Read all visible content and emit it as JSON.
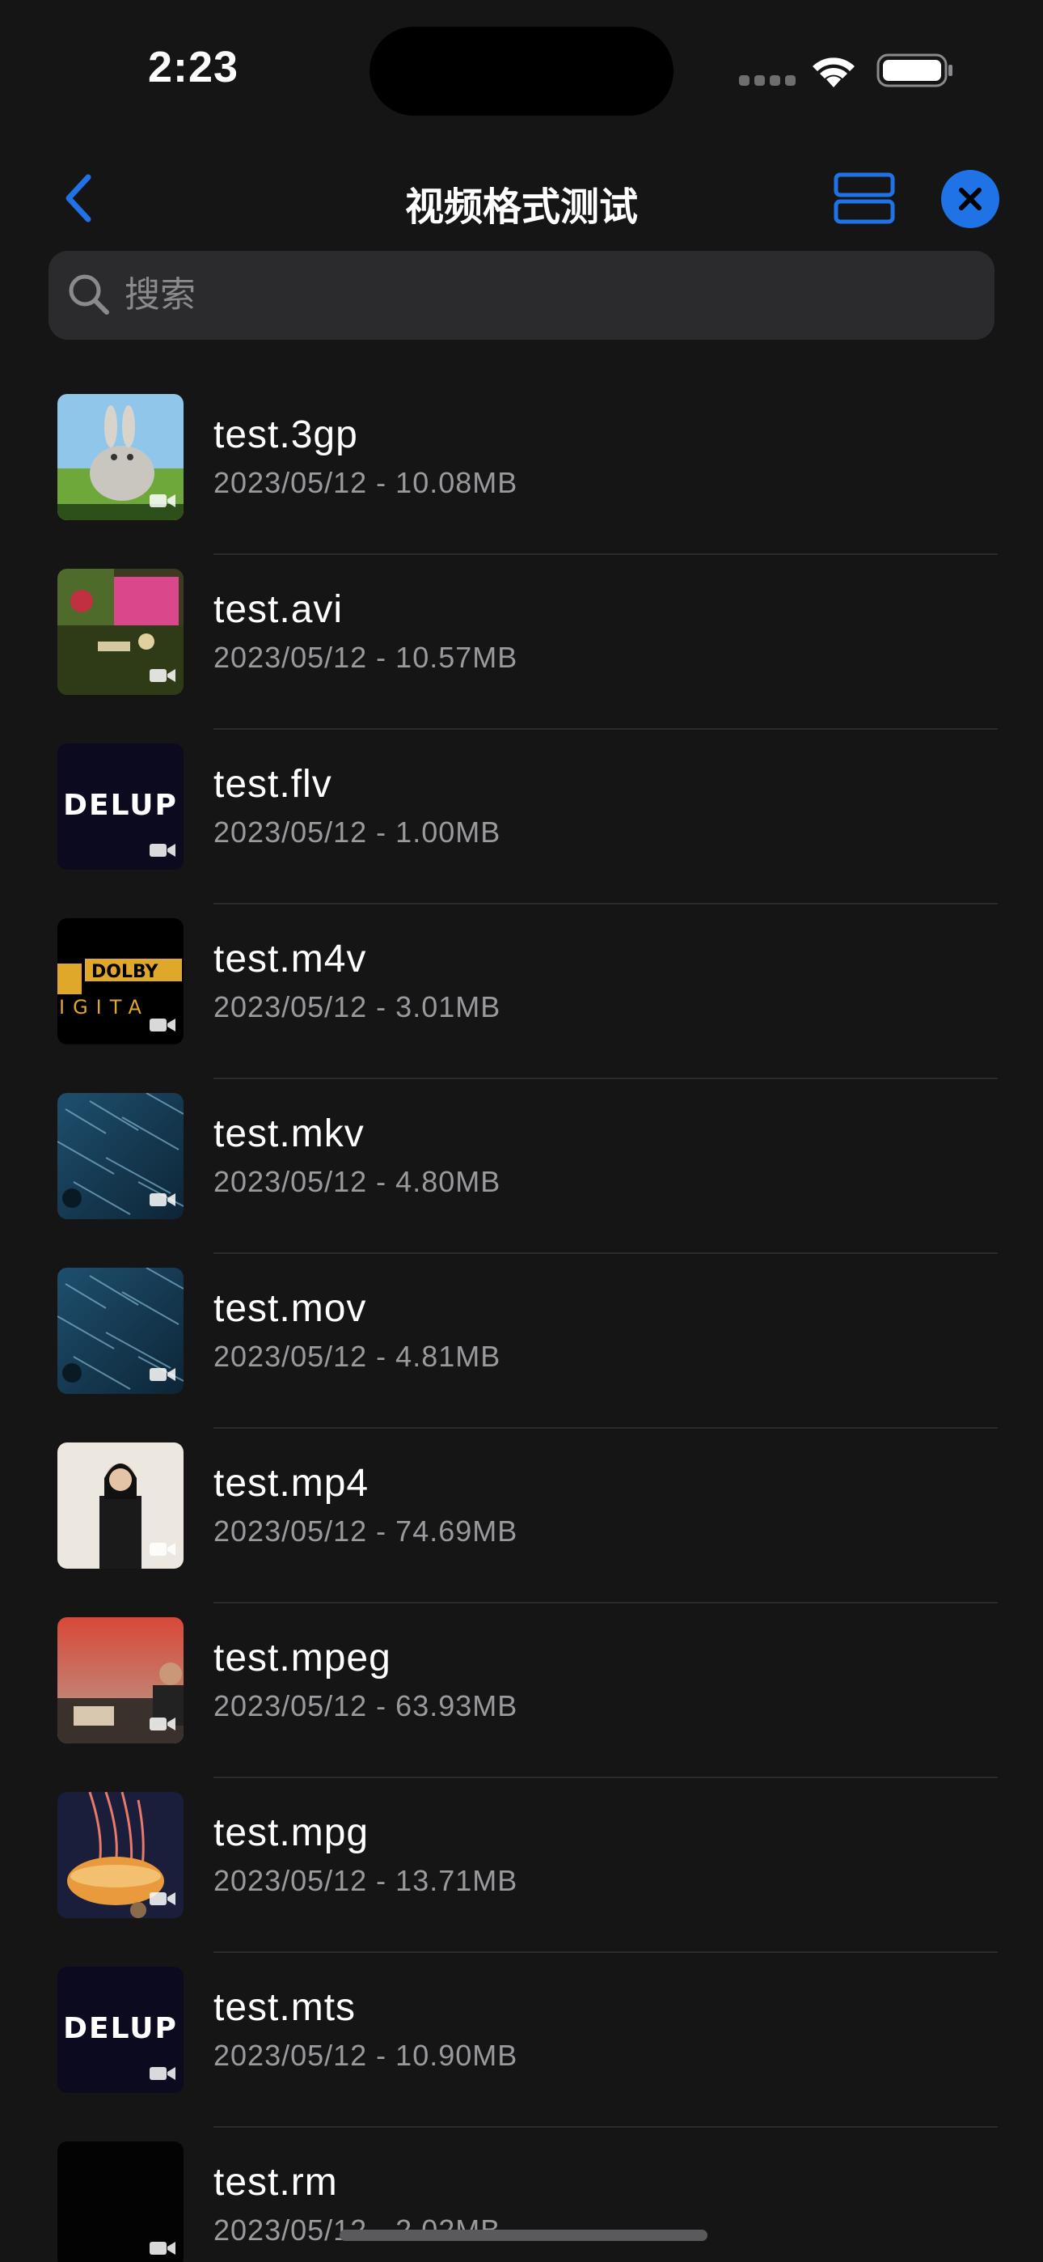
{
  "status_bar": {
    "time": "2:23"
  },
  "nav": {
    "title": "视频格式测试",
    "accent_color": "#1f73e6"
  },
  "search": {
    "placeholder": "搜索",
    "value": ""
  },
  "files": [
    {
      "name": "test.3gp",
      "meta": "2023/05/12 - 10.08MB",
      "thumb": "bunny"
    },
    {
      "name": "test.avi",
      "meta": "2023/05/12 - 10.57MB",
      "thumb": "garden"
    },
    {
      "name": "test.flv",
      "meta": "2023/05/12 - 1.00MB",
      "thumb": "delup",
      "thumb_text": "DELUP"
    },
    {
      "name": "test.m4v",
      "meta": "2023/05/12 - 3.01MB",
      "thumb": "dolby",
      "thumb_text": "DOLBY",
      "thumb_text2": "IGITA"
    },
    {
      "name": "test.mkv",
      "meta": "2023/05/12 - 4.80MB",
      "thumb": "rain"
    },
    {
      "name": "test.mov",
      "meta": "2023/05/12 - 4.81MB",
      "thumb": "rain"
    },
    {
      "name": "test.mp4",
      "meta": "2023/05/12 - 74.69MB",
      "thumb": "person"
    },
    {
      "name": "test.mpeg",
      "meta": "2023/05/12 - 63.93MB",
      "thumb": "interview"
    },
    {
      "name": "test.mpg",
      "meta": "2023/05/12 - 13.71MB",
      "thumb": "jellyfish"
    },
    {
      "name": "test.mts",
      "meta": "2023/05/12 - 10.90MB",
      "thumb": "delup",
      "thumb_text": "DELUP"
    },
    {
      "name": "test.rm",
      "meta": "2023/05/12 - 2.02MB",
      "thumb": "black"
    }
  ]
}
